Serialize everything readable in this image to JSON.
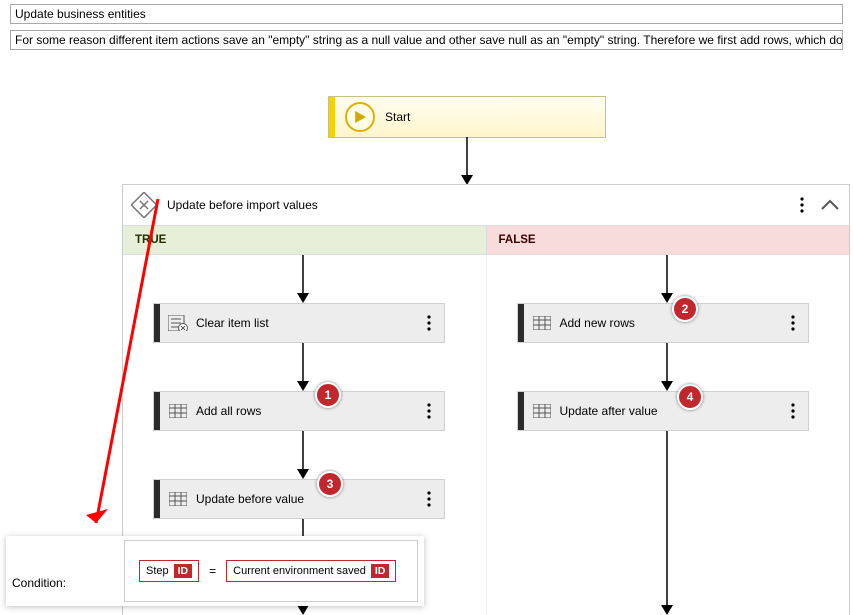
{
  "fields": {
    "title": "Update business entities",
    "description": "For some reason different item actions save an \"empty\" string as a null value and other save null as an \"empty\" string. Therefore we first add rows, which don't yet exist in th"
  },
  "start": {
    "label": "Start"
  },
  "container": {
    "title": "Update before import values",
    "true_label": "TRUE",
    "false_label": "FALSE"
  },
  "true_actions": [
    {
      "label": "Clear item list",
      "badge": ""
    },
    {
      "label": "Add all rows",
      "badge": "1"
    },
    {
      "label": "Update before value",
      "badge": "3"
    }
  ],
  "false_actions": [
    {
      "label": "Add new rows",
      "badge": "2"
    },
    {
      "label": "Update after value",
      "badge": "4"
    }
  ],
  "condition": {
    "label": "Condition:",
    "lhs": "Step",
    "lhs_tag": "ID",
    "op": "=",
    "rhs": "Current environment saved",
    "rhs_tag": "ID"
  }
}
